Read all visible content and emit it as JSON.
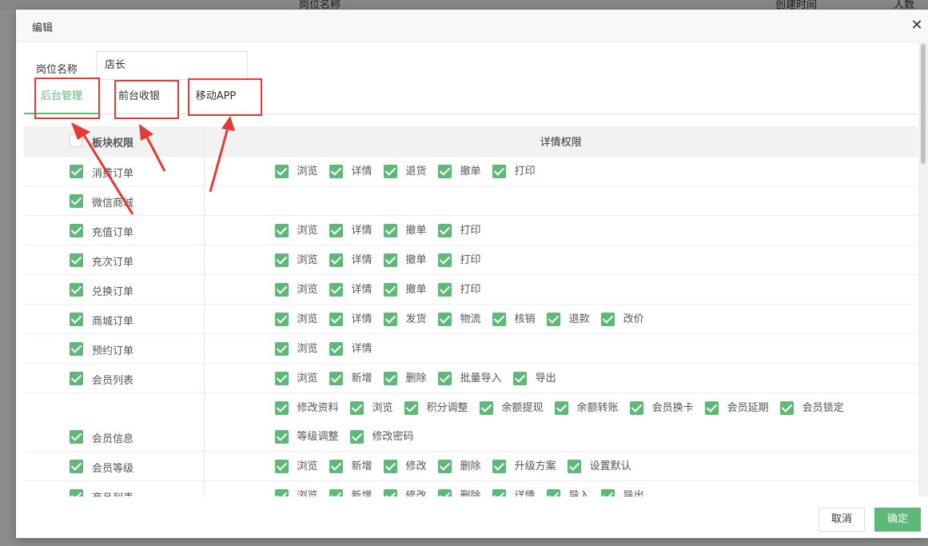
{
  "background": {
    "headers": [
      "岗位名称",
      "创建时间",
      "人数"
    ]
  },
  "dialog": {
    "title": "编辑",
    "close_icon": "close-icon",
    "position_label": "岗位名称",
    "position_value": "店长",
    "tabs": [
      {
        "label": "后台管理",
        "active": true
      },
      {
        "label": "前台收银",
        "active": false
      },
      {
        "label": "移动APP",
        "active": false
      }
    ],
    "table_header": {
      "left": "板块权限",
      "right": "详情权限"
    },
    "rows": [
      {
        "module": "消费订单",
        "perms": [
          "浏览",
          "详情",
          "退货",
          "撤单",
          "打印"
        ]
      },
      {
        "module": "微信商城",
        "perms": []
      },
      {
        "module": "充值订单",
        "perms": [
          "浏览",
          "详情",
          "撤单",
          "打印"
        ]
      },
      {
        "module": "充次订单",
        "perms": [
          "浏览",
          "详情",
          "撤单",
          "打印"
        ]
      },
      {
        "module": "兑换订单",
        "perms": [
          "浏览",
          "详情",
          "撤单",
          "打印"
        ]
      },
      {
        "module": "商城订单",
        "perms": [
          "浏览",
          "详情",
          "发货",
          "物流",
          "核销",
          "退款",
          "改价"
        ]
      },
      {
        "module": "预约订单",
        "perms": [
          "浏览",
          "详情"
        ]
      },
      {
        "module": "会员列表",
        "perms": [
          "浏览",
          "新增",
          "删除",
          "批量导入",
          "导出"
        ]
      },
      {
        "module": "会员信息",
        "perms": [
          "修改资料",
          "浏览",
          "积分调整",
          "余额提现",
          "余额转账",
          "会员换卡",
          "会员延期",
          "会员锁定"
        ],
        "perms2": [
          "等级调整",
          "修改密码"
        ]
      },
      {
        "module": "会员等级",
        "perms": [
          "浏览",
          "新增",
          "修改",
          "删除",
          "升级方案",
          "设置默认"
        ]
      },
      {
        "module": "商品列表",
        "perms": [
          "浏览",
          "新增",
          "修改",
          "删除",
          "详情",
          "导入",
          "导出"
        ]
      }
    ],
    "buttons": {
      "cancel": "取消",
      "confirm": "确定"
    }
  },
  "colors": {
    "accent": "#5FB878",
    "annotation": "#e53935"
  }
}
